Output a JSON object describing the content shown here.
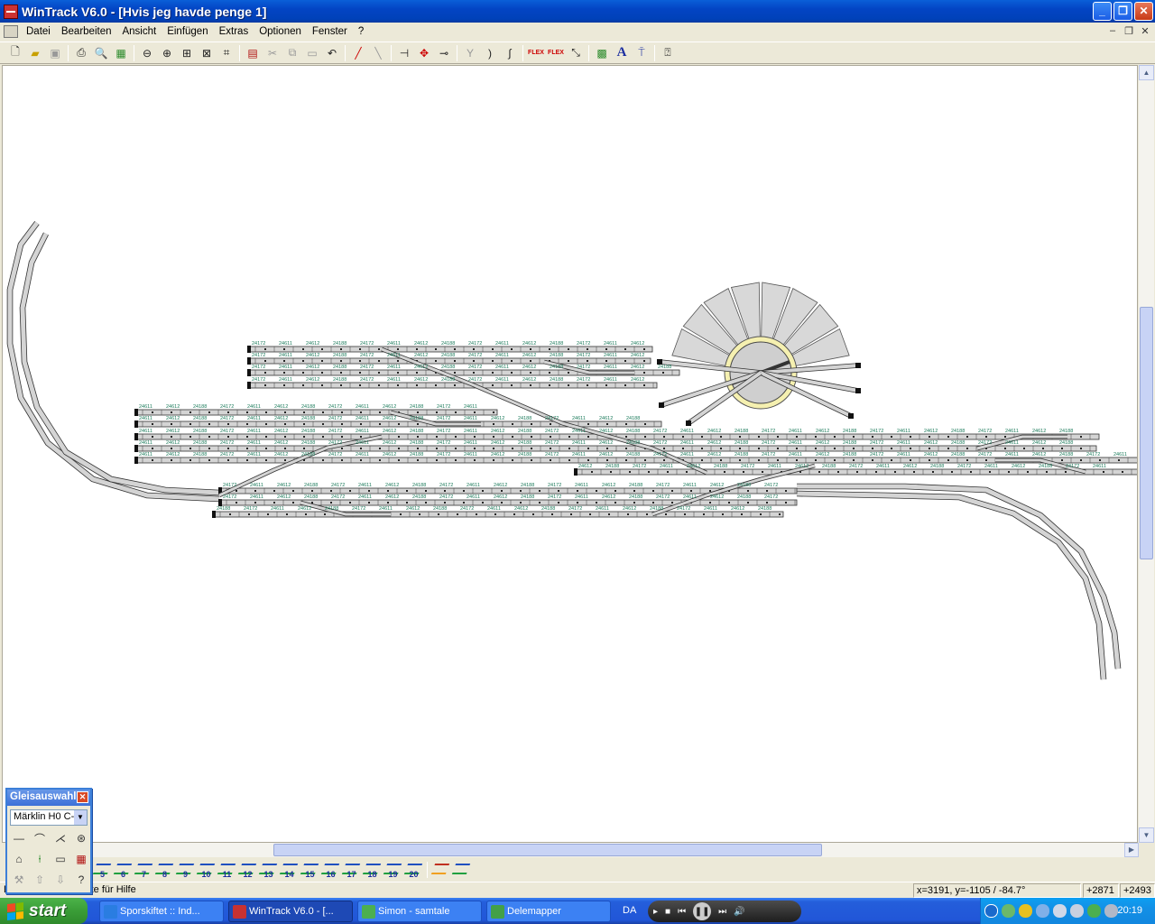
{
  "window": {
    "title": "WinTrack  V6.0 - [Hvis jeg havde penge 1]",
    "buttons": {
      "minimize": "_",
      "restore": "❐",
      "close": "✕"
    }
  },
  "menu": {
    "items": [
      "Datei",
      "Bearbeiten",
      "Ansicht",
      "Einfügen",
      "Extras",
      "Optionen",
      "Fenster",
      "?"
    ]
  },
  "toolbar": {
    "icons": [
      "new-file-icon",
      "open-folder-icon",
      "save-icon",
      "print-icon",
      "print-preview-icon",
      "image-export-icon",
      "zoom-out-icon",
      "zoom-in-icon",
      "zoom-window-icon",
      "zoom-all-icon",
      "zoom-fit-icon",
      "piece-list-icon",
      "cut-icon",
      "copy-icon",
      "paste-icon",
      "undo-icon",
      "track-connect-icon",
      "track-disconnect-icon",
      "track-split-icon",
      "track-move-icon",
      "track-cut-icon",
      "switch-icon",
      "curve-icon",
      "flex-track-icon",
      "flex-track-red-icon",
      "flex-track-edit-icon",
      "flex-track-bend-icon",
      "landscape-icon",
      "text-icon",
      "signal-icon",
      "context-help-icon"
    ],
    "flex_label": "FLEX"
  },
  "canvas": {
    "track_labels": [
      "24172",
      "24188",
      "24612",
      "24611",
      "978",
      "077",
      "694",
      "24130",
      "24912",
      "24224"
    ]
  },
  "palette": {
    "title": "Gleisauswahl",
    "close": "✕",
    "selected_system": "Märklin H0 C-"
  },
  "layers": {
    "numbers": [
      "5",
      "6",
      "7",
      "8",
      "9",
      "10",
      "11",
      "12",
      "13",
      "14",
      "15",
      "16",
      "17",
      "18",
      "19",
      "20"
    ]
  },
  "status": {
    "help": "Drücken Sie F1-Taste für Hilfe",
    "coords": "x=3191, y=-1105 / -84.7°",
    "x_offset": "+2871",
    "y_offset": "+2493"
  },
  "taskbar": {
    "start": "start",
    "tasks": [
      {
        "label": "Sporskiftet :: Ind...",
        "color": "#2a7de1"
      },
      {
        "label": "WinTrack  V6.0 - [...",
        "color": "#c83232"
      },
      {
        "label": "Simon - samtale",
        "color": "#4caf50"
      },
      {
        "label": "Delemapper",
        "color": "#43a047"
      }
    ],
    "language": "DA",
    "clock": "20:19"
  },
  "colors": {
    "title_blue": "#0344c4",
    "track_fill": "#d4d4d4",
    "label_green": "#1a7a5a"
  }
}
